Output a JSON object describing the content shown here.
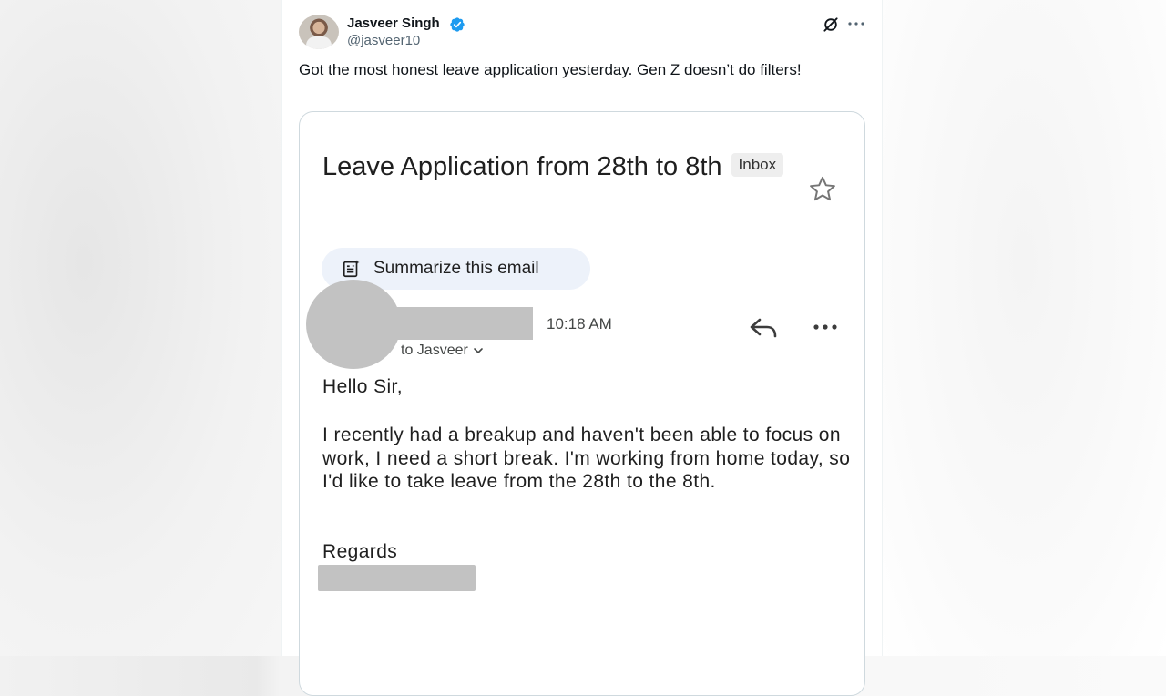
{
  "post": {
    "author_name": "Jasveer Singh",
    "handle": "@jasveer10",
    "text": "Got the most honest leave application yesterday. Gen Z doesn’t do filters!"
  },
  "icons": {
    "verified": "verified-badge-icon",
    "grok": "grok-icon",
    "more": "more-icon",
    "star": "star-icon",
    "summarize": "summarize-icon",
    "reply": "reply-icon",
    "chevron": "chevron-down-icon"
  },
  "colors": {
    "verified_blue": "#1d9bf0",
    "summarize_chip_bg": "#edf2fa",
    "redaction_gray": "#c2c2c2"
  },
  "email": {
    "subject": "Leave Application from 28th to 8th",
    "label_chip": "Inbox",
    "summarize_label": "Summarize this email",
    "time": "10:18 AM",
    "to_line": "to Jasveer",
    "greeting": "Hello Sir,",
    "body": "I recently had a breakup and haven't been able to focus on work, I need a short break. I'm working from home today, so I'd like to take leave from the 28th to the 8th.",
    "closing": "Regards"
  }
}
